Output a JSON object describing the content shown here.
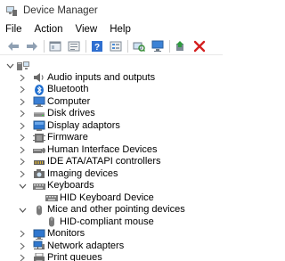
{
  "window": {
    "title": "Device Manager"
  },
  "menu": [
    "File",
    "Action",
    "View",
    "Help"
  ],
  "toolbar": {
    "buttons": [
      "back-icon",
      "forward-icon",
      "properties-sheet-icon",
      "show-hidden-icon",
      "help-icon",
      "view-list-icon",
      "scan-hardware-icon",
      "monitor-icon",
      "update-driver-icon",
      "uninstall-icon"
    ]
  },
  "tree": {
    "root_icon": "computer-root-icon",
    "items": [
      {
        "label": "Audio inputs and outputs",
        "icon": "speaker-icon"
      },
      {
        "label": "Bluetooth",
        "icon": "bluetooth-icon"
      },
      {
        "label": "Computer",
        "icon": "computer-icon"
      },
      {
        "label": "Disk drives",
        "icon": "disk-drive-icon"
      },
      {
        "label": "Display adaptors",
        "icon": "display-adapter-icon"
      },
      {
        "label": "Firmware",
        "icon": "firmware-icon"
      },
      {
        "label": "Human Interface Devices",
        "icon": "hid-icon"
      },
      {
        "label": "IDE ATA/ATAPI controllers",
        "icon": "ide-controller-icon"
      },
      {
        "label": "Imaging devices",
        "icon": "camera-icon"
      },
      {
        "label": "Keyboards",
        "icon": "keyboard-icon",
        "expanded": true
      },
      {
        "label": "HID Keyboard Device",
        "icon": "keyboard-icon",
        "child": true
      },
      {
        "label": "Mice and other pointing devices",
        "icon": "mouse-icon",
        "expanded": true
      },
      {
        "label": "HID-compliant mouse",
        "icon": "mouse-icon",
        "child": true
      },
      {
        "label": "Monitors",
        "icon": "monitor-icon"
      },
      {
        "label": "Network adapters",
        "icon": "network-adapter-icon"
      },
      {
        "label": "Print queues",
        "icon": "printer-icon"
      }
    ]
  }
}
